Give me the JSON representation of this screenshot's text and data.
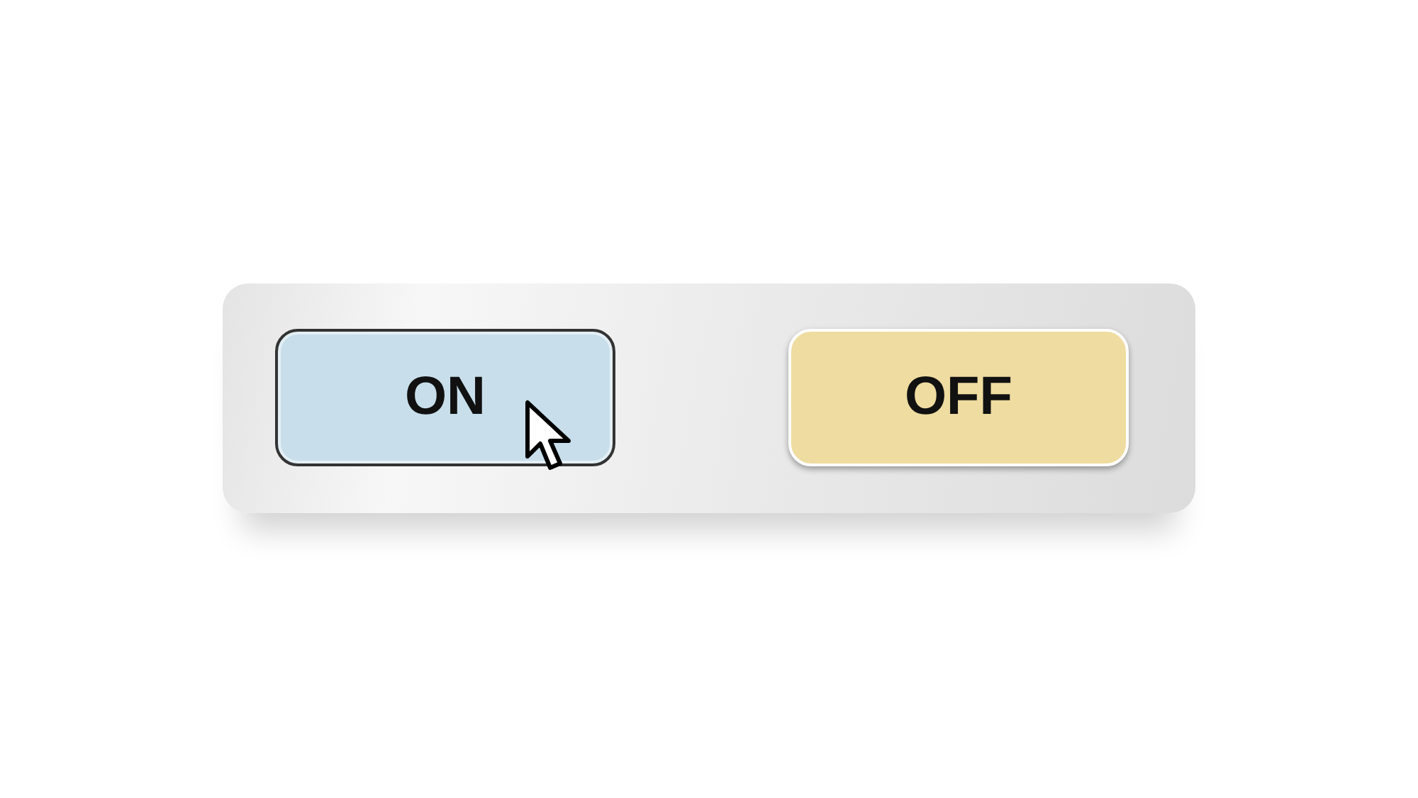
{
  "buttons": [
    {
      "label": "ON",
      "pressed": true,
      "hovered": true,
      "color": "#c8dfeb"
    },
    {
      "label": "OFF",
      "pressed": false,
      "hovered": false,
      "color": "#efdca0"
    }
  ]
}
